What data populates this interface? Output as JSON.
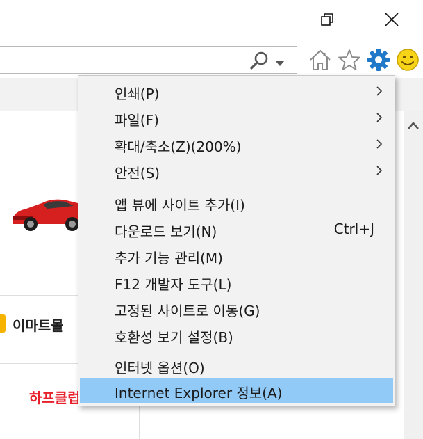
{
  "window": {
    "restore_icon": "restore-icon",
    "close_icon": "close-icon"
  },
  "addressbar": {
    "value": "",
    "search_icon": "search-icon",
    "dropdown_icon": "chevron-down-icon"
  },
  "toolbar": {
    "icons": [
      "home-icon",
      "star-icon",
      "gear-icon",
      "smiley-icon"
    ],
    "accent_color": "#1f78c8"
  },
  "page": {
    "emart_label": "이마트몰",
    "red_label": "하프클럽",
    "red_color": "#e8202a",
    "badge_color": "#f6b400"
  },
  "menu": {
    "highlight_color": "#91c9f7",
    "group1": [
      {
        "label": "인쇄(P)",
        "submenu": true
      },
      {
        "label": "파일(F)",
        "submenu": true
      },
      {
        "label": "확대/축소(Z)(200%)",
        "submenu": true
      },
      {
        "label": "안전(S)",
        "submenu": true
      }
    ],
    "group2": [
      {
        "label": "앱 뷰에 사이트 추가(I)",
        "shortcut": ""
      },
      {
        "label": "다운로드 보기(N)",
        "shortcut": "Ctrl+J"
      },
      {
        "label": "추가 기능 관리(M)",
        "shortcut": ""
      },
      {
        "label": "F12 개발자 도구(L)",
        "shortcut": ""
      },
      {
        "label": "고정된 사이트로 이동(G)",
        "shortcut": ""
      },
      {
        "label": "호환성 보기 설정(B)",
        "shortcut": ""
      }
    ],
    "group3": [
      {
        "label": "인터넷 옵션(O)",
        "selected": false
      },
      {
        "label": "Internet Explorer 정보(A)",
        "selected": true
      }
    ]
  }
}
